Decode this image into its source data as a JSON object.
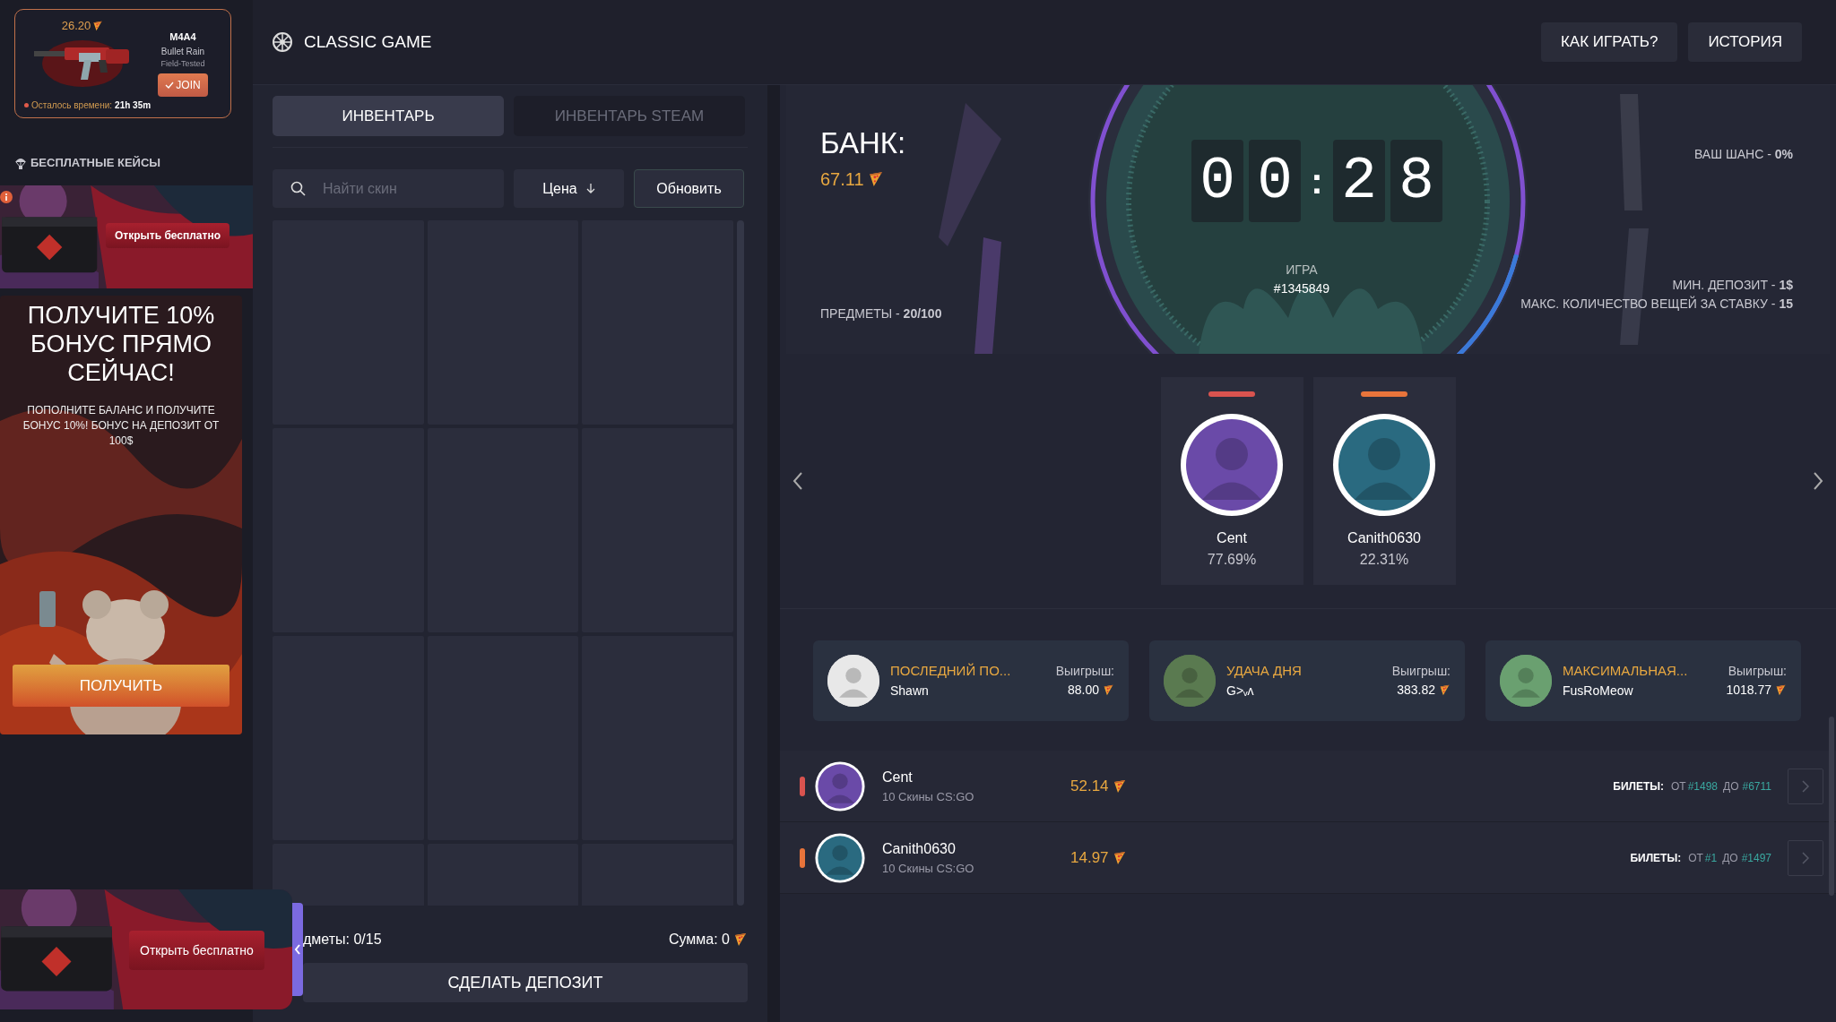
{
  "featured": {
    "price": "26.20",
    "weapon": "M4A4",
    "skin": "Bullet Rain",
    "wear": "Field-Tested",
    "join": "JOIN",
    "time_label": "Осталось времени:",
    "time": "21h 35m"
  },
  "sidebar": {
    "free_cases_title": "БЕСПЛАТНЫЕ КЕЙСЫ",
    "case_button": "Открыть бесплатно",
    "promo": {
      "title": "ПОЛУЧИТЕ 10% БОНУС ПРЯМО СЕЙЧАС!",
      "text": "ПОПОЛНИТЕ БАЛАНС И ПОЛУЧИТЕ БОНУС 10%! БОНУС НА ДЕПОЗИТ ОТ 100$",
      "button": "ПОЛУЧИТЬ"
    },
    "floating_case_button": "Открыть бесплатно"
  },
  "header": {
    "title": "CLASSIC GAME",
    "buttons": [
      "КАК ИГРАТЬ?",
      "ИСТОРИЯ"
    ]
  },
  "inventory": {
    "tabs": [
      {
        "label": "ИНВЕНТАРЬ",
        "selected": true
      },
      {
        "label": "ИНВЕНТАРЬ STEAM",
        "selected": false
      }
    ],
    "search": {
      "placeholder": "Найти скин"
    },
    "sort": "Цена",
    "refresh": "Обновить",
    "items_count": "дметы: 0/15",
    "sum": "Сумма: 0",
    "deposit": "СДЕЛАТЬ ДЕПОЗИТ"
  },
  "game": {
    "bank_label": "БАНК:",
    "bank": "67.11",
    "items": "ПРЕДМЕТЫ - **20/100**",
    "timer": [
      {
        "kind": "digit",
        "text": "0"
      },
      {
        "kind": "digit",
        "text": "0"
      },
      {
        "kind": "separator",
        "text": ":"
      },
      {
        "kind": "digit",
        "text": "2"
      },
      {
        "kind": "digit",
        "text": "8"
      }
    ],
    "game_label": "ИГРА",
    "game_number": "#1345849",
    "chance": "ВАШ ШАНС - **0%**",
    "min_deposit": "МИН. ДЕПОЗИТ - **1$**",
    "max_items": "МАКС. КОЛИЧЕСТВО ВЕЩЕЙ ЗА СТАВКУ - **15**"
  },
  "participants": [
    {
      "name": "Cent",
      "chance": "77.69%",
      "color": "#d9534f"
    },
    {
      "name": "Canith0630",
      "chance": "22.31%",
      "color": "#e8743b"
    }
  ],
  "winners": [
    {
      "title": "ПОСЛЕДНИЙ ПО...",
      "name": "Shawn",
      "win_label": "Выигрыш:",
      "amount": "88.00"
    },
    {
      "title": "УДАЧА ДНЯ",
      "name": "G>ᵥᴧ",
      "win_label": "Выигрыш:",
      "amount": "383.82"
    },
    {
      "title": "МАКСИМАЛЬНАЯ...",
      "name": "FusRoMeow",
      "win_label": "Выигрыш:",
      "amount": "1018.77"
    }
  ],
  "bets": [
    {
      "name": "Cent",
      "items": "10 Скины CS:GO",
      "amount": "52.14",
      "tickets_label": "БИЛЕТЫ:",
      "from_label": "ОТ",
      "from": "#1498",
      "to_label": "ДО",
      "to": "#6711",
      "color": "#d9534f"
    },
    {
      "name": "Canith0630",
      "items": "10 Скины CS:GO",
      "amount": "14.97",
      "tickets_label": "БИЛЕТЫ:",
      "from_label": "ОТ",
      "from": "#1",
      "to_label": "ДО",
      "to": "#1497",
      "color": "#e8743b"
    }
  ]
}
